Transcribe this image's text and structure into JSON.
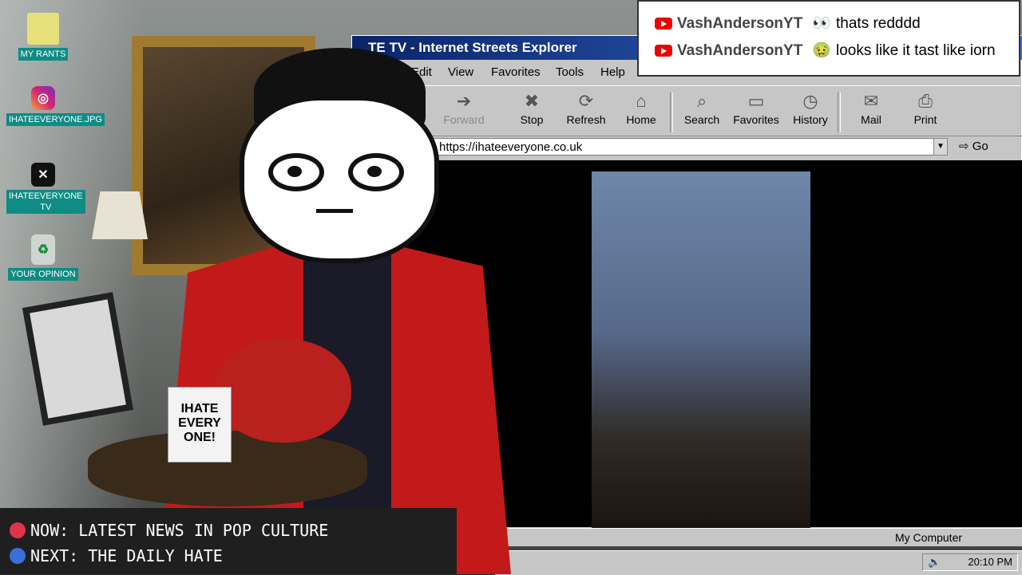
{
  "desktop": {
    "icons": [
      {
        "label": "MY RANTS",
        "icon": "folder-icon"
      },
      {
        "label": "IHATEEVERYONE.JPG",
        "icon": "instagram-icon"
      },
      {
        "label": "IHATEEVERYONE TV",
        "icon": "x-icon"
      },
      {
        "label": "YOUR OPINION",
        "icon": "recycle-bin-icon"
      }
    ]
  },
  "browser": {
    "title": "TE TV - Internet Streets Explorer",
    "menu": [
      "Edit",
      "View",
      "Favorites",
      "Tools",
      "Help"
    ],
    "toolbar": {
      "forward": "Forward",
      "stop": "Stop",
      "refresh": "Refresh",
      "home": "Home",
      "search": "Search",
      "favorites": "Favorites",
      "history": "History",
      "mail": "Mail",
      "print": "Print"
    },
    "address": "https://ihateeveryone.co.uk",
    "go": "Go",
    "status_right": "My Computer"
  },
  "chat": {
    "messages": [
      {
        "user": "VashAndersonYT",
        "emoji": "👀",
        "text": "thats redddd"
      },
      {
        "user": "VashAndersonYT",
        "emoji": "🤢",
        "text": "looks like it tast like iorn"
      }
    ]
  },
  "props": {
    "mug_text": "IHATE EVERY ONE!"
  },
  "lower_third": {
    "now": "NOW: LATEST NEWS IN POP CULTURE",
    "next": "NEXT: THE DAILY HATE"
  },
  "taskbar": {
    "clock": "20:10 PM"
  },
  "colors": {
    "ie_title": "#0a246a",
    "chrome": "#c6c6c6",
    "jacket": "#c21a1a",
    "icon_label": "#0f8c84",
    "now_dot": "#e0344a",
    "next_dot": "#3a6fd8"
  }
}
